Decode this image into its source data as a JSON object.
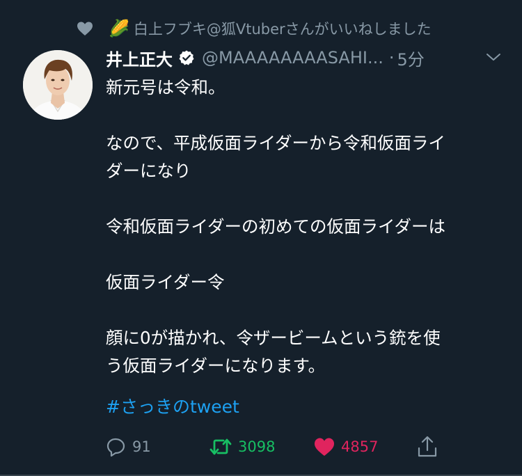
{
  "social_context": {
    "icon": "heart-icon",
    "emoji": "🌽",
    "text": "白上フブキ@狐Vtuberさんがいいねしました"
  },
  "tweet": {
    "display_name": "井上正大",
    "verified_icon": "verified-badge-icon",
    "handle": "@MAAAAAAAASAHI...",
    "dot": "·",
    "time": "5分",
    "body": {
      "line1": "新元号は令和。",
      "line2": "なので、平成仮面ライダーから令和仮面ライ",
      "line3": "ダーになり",
      "line4": "令和仮面ライダーの初めての仮面ライダーは",
      "line5": "仮面ライダー令",
      "line6": "顔に0が描かれ、令ザービームという銃を使",
      "line7": "う仮面ライダーになります。"
    },
    "hashtag": "#さっきのtweet"
  },
  "actions": {
    "reply_count": "91",
    "retweet_count": "3098",
    "like_count": "4857"
  },
  "colors": {
    "background": "#15202b",
    "secondary_text": "#8899a6",
    "link": "#1da1f2",
    "retweet_active": "#17bf63",
    "like_active": "#e0245e"
  }
}
